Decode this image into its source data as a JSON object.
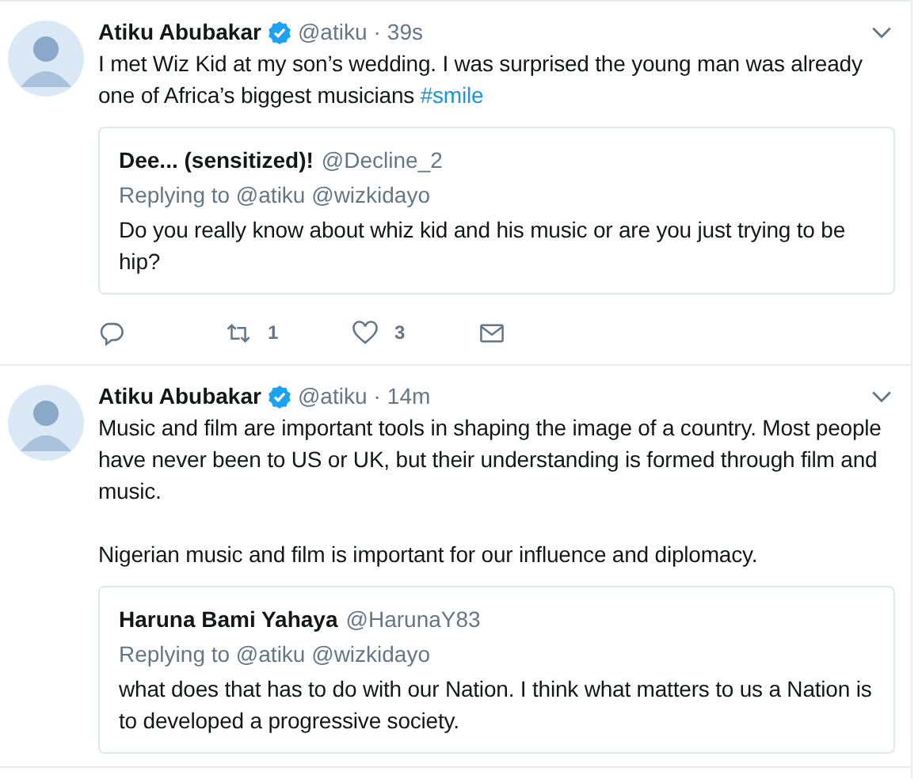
{
  "tweets": [
    {
      "name": "Atiku Abubakar",
      "verified": true,
      "handle": "@atiku",
      "dot": "·",
      "time": "39s",
      "paragraphs": [
        {
          "text": "I met Wiz Kid at my son’s wedding. I was surprised the young man was already one of Africa’s biggest musicians ",
          "hashtag": "#smile"
        }
      ],
      "quote": {
        "name": "Dee... (sensitized)!",
        "handle": "@Decline_2",
        "replying": "Replying to @atiku @wizkidayo",
        "text": "Do you really know about whiz kid and his music or are you just trying to be hip?"
      },
      "actions": {
        "retweets": "1",
        "likes": "3"
      }
    },
    {
      "name": "Atiku Abubakar",
      "verified": true,
      "handle": "@atiku",
      "dot": "·",
      "time": "14m",
      "paragraphs": [
        {
          "text": "Music and film are important tools in shaping the image of a country. Most people have never been to US or UK, but their understanding is formed through film and music."
        },
        {
          "text": "Nigerian music and film is important for our influence and diplomacy."
        }
      ],
      "quote": {
        "name": "Haruna Bami Yahaya",
        "handle": "@HarunaY83",
        "replying": "Replying to @atiku @wizkidayo",
        "text": "what does that has to do with our Nation. I think what matters to us a Nation is to developed a progressive society."
      }
    }
  ]
}
